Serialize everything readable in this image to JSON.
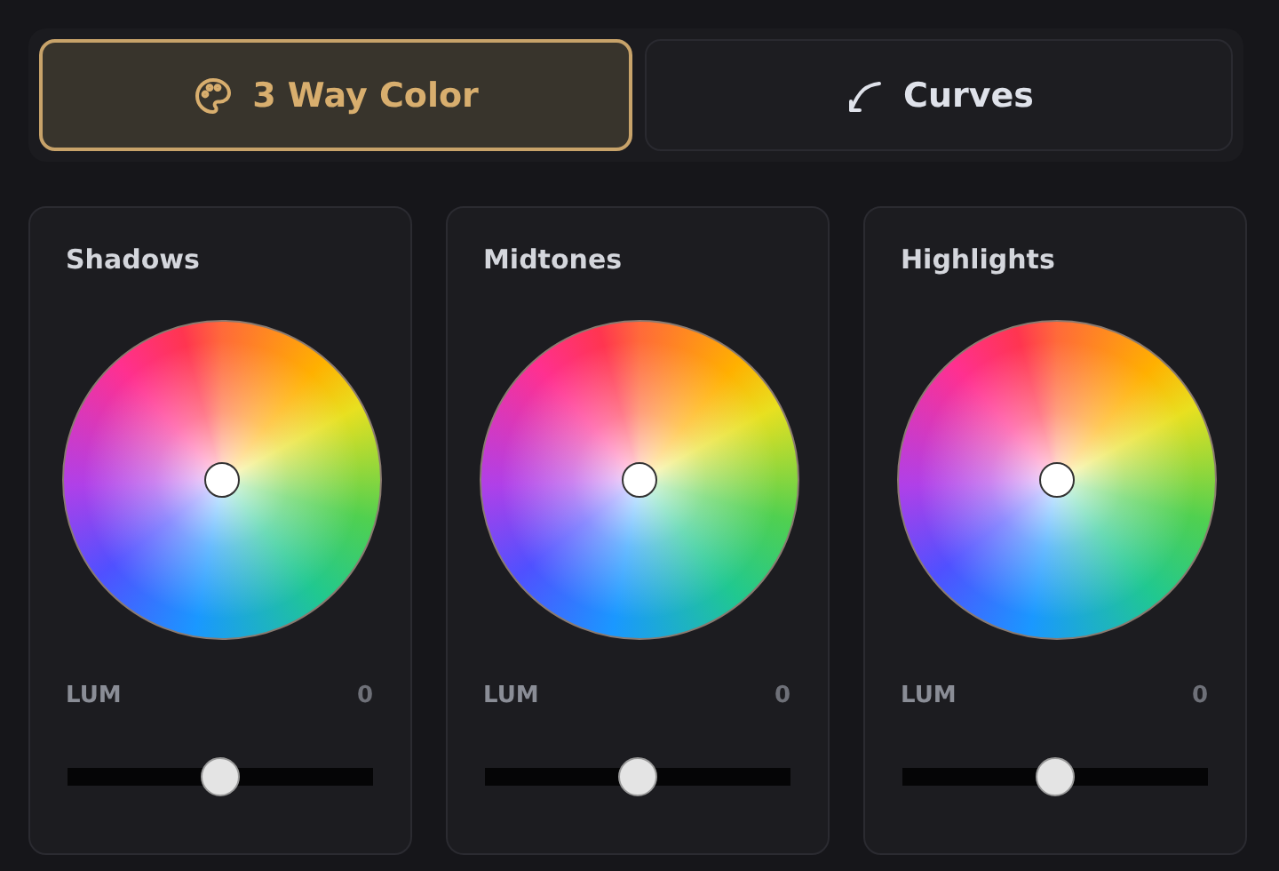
{
  "tabs": [
    {
      "label": "3 Way Color",
      "selected": true
    },
    {
      "label": "Curves",
      "selected": false
    }
  ],
  "panels": [
    {
      "title": "Shadows",
      "slider_label": "LUM",
      "slider_value": "0",
      "level": 0.5
    },
    {
      "title": "Midtones",
      "slider_label": "LUM",
      "slider_value": "0",
      "level": 0.5
    },
    {
      "title": "Highlights",
      "slider_label": "LUM",
      "slider_value": "0",
      "level": 0.5
    }
  ]
}
